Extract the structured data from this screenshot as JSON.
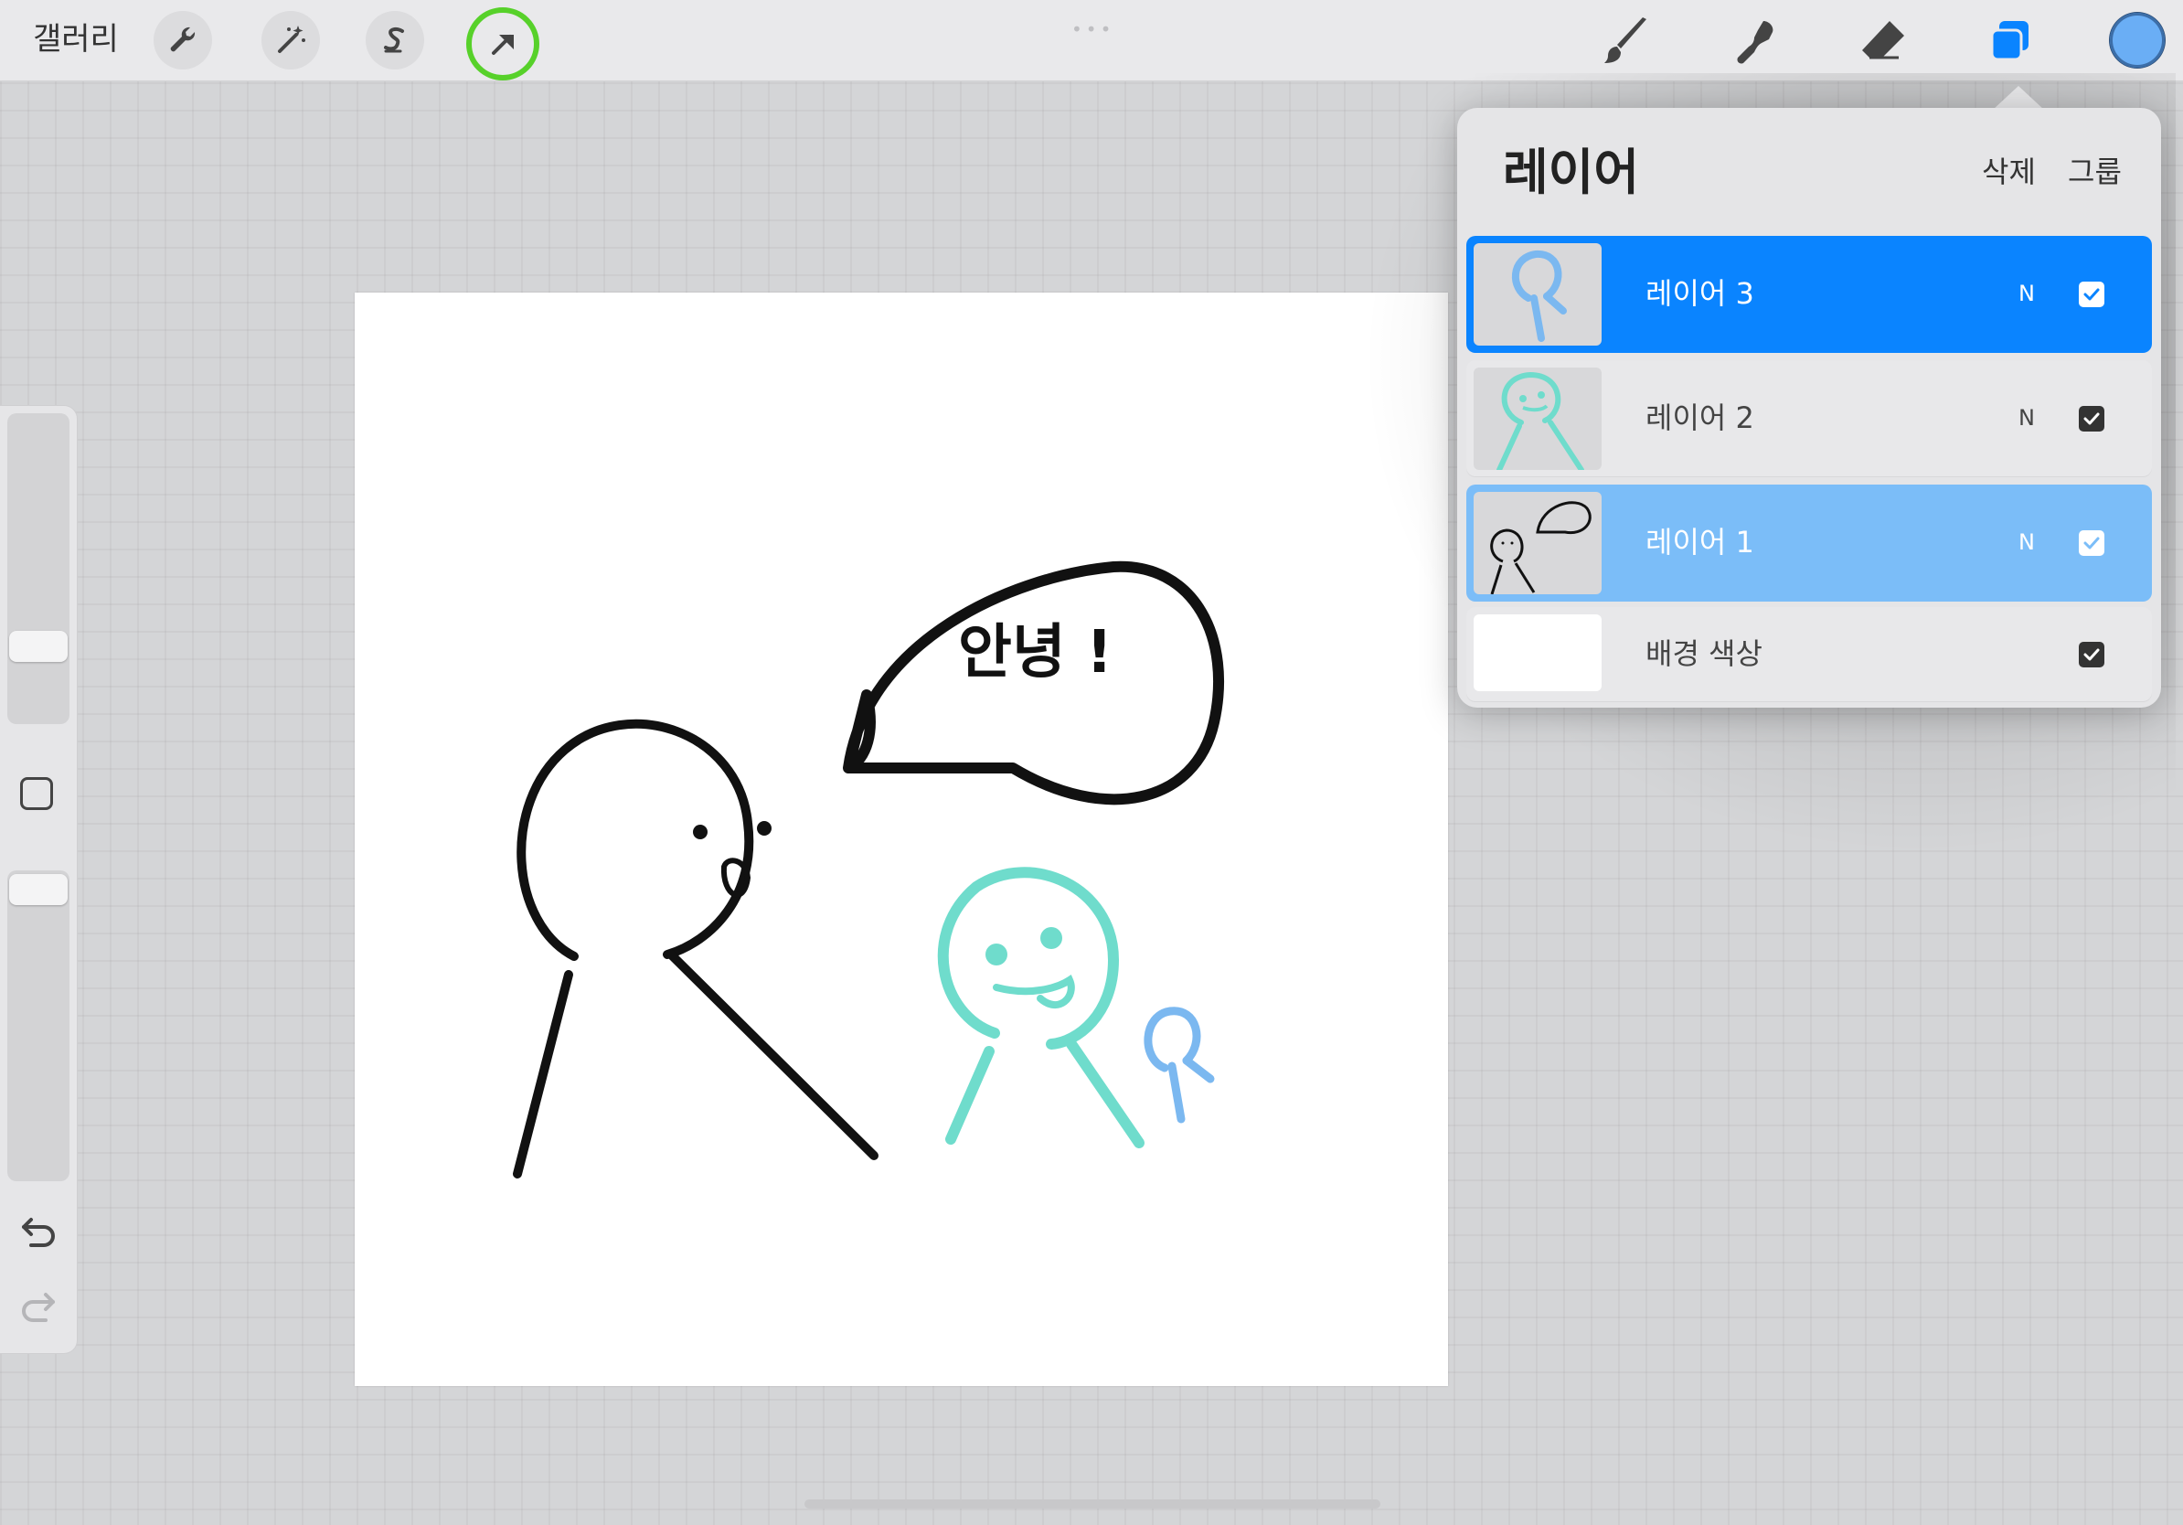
{
  "toolbar": {
    "gallery_label": "갤러리",
    "left_tools": [
      {
        "name": "wrench-icon",
        "label": "actions"
      },
      {
        "name": "magic-wand-icon",
        "label": "adjustments"
      },
      {
        "name": "selection-icon",
        "label": "selection"
      },
      {
        "name": "transform-arrow-icon",
        "label": "transform",
        "active": true
      }
    ],
    "right_tools": [
      "brush-icon",
      "smudge-icon",
      "eraser-icon",
      "layers-icon"
    ],
    "active_color": "#6aaef5",
    "active_tool_ring_color": "#57d12a",
    "layers_icon_color": "#0a84ff"
  },
  "layers_panel": {
    "title": "레이어",
    "delete_label": "삭제",
    "group_label": "그룹",
    "layers": [
      {
        "name": "레이어 3",
        "blend": "N",
        "visible": true,
        "state": "primary-selected"
      },
      {
        "name": "레이어 2",
        "blend": "N",
        "visible": true,
        "state": "normal"
      },
      {
        "name": "레이어 1",
        "blend": "N",
        "visible": true,
        "state": "secondary-selected"
      },
      {
        "name": "배경 색상",
        "blend": "",
        "visible": true,
        "state": "background"
      }
    ]
  },
  "canvas": {
    "speech_text": "안녕 !",
    "stroke_colors": {
      "black": "#111111",
      "teal": "#6fdccc",
      "blue": "#7bb8f0"
    }
  }
}
